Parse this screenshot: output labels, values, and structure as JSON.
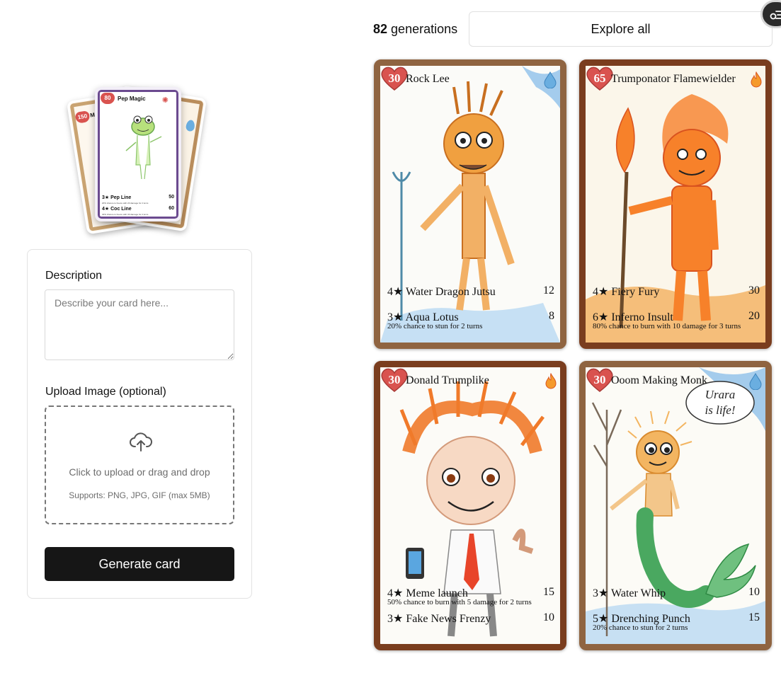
{
  "logo": {
    "back_card": {
      "hp": "150",
      "name": "M"
    },
    "front_card": {
      "hp": "80",
      "name": "Pep Magic",
      "attacks": [
        {
          "label": "3★ Pep Line",
          "damage": "50",
          "effect": "20% chance to freeze with 20 damage for 2 turns"
        },
        {
          "label": "4★ Coc Line",
          "damage": "60",
          "effect": "40% chance to freeze with 30 damage for 2 turns"
        }
      ]
    }
  },
  "form": {
    "description_label": "Description",
    "description_placeholder": "Describe your card here...",
    "upload_label": "Upload Image (optional)",
    "upload_main": "Click to upload or drag and drop",
    "upload_sub": "Supports: PNG, JPG, GIF (max 5MB)",
    "generate_label": "Generate card"
  },
  "header": {
    "count": "82",
    "count_suffix": "generations",
    "explore_label": "Explore all"
  },
  "cards": [
    {
      "hp": "30",
      "name": "Rock Lee",
      "element": "water",
      "attack1": {
        "label": "4★ Water Dragon Jutsu",
        "damage": "12"
      },
      "attack2": {
        "label": "3★ Aqua Lotus",
        "damage": "8"
      },
      "effect": "20% chance to stun  for 2 turns"
    },
    {
      "hp": "65",
      "name": "Trumponator Flamewielder",
      "element": "fire",
      "attack1": {
        "label": "4★ Fiery Fury",
        "damage": "30"
      },
      "attack2": {
        "label": "6★ Inferno Insult",
        "damage": "20"
      },
      "effect": "80% chance to burn with 10 damage for 3 turns"
    },
    {
      "hp": "30",
      "name": "Donald Trumplike",
      "element": "fire",
      "attack1": {
        "label": "4★ Meme launch",
        "damage": "15"
      },
      "attack2": {
        "label": "3★ Fake News Frenzy",
        "damage": "10"
      },
      "effect": "50% chance to burn with 5 damage for 2 turns"
    },
    {
      "hp": "30",
      "name": "Ooom Making Monk",
      "element": "water",
      "attack1": {
        "label": "3★ Water Whip",
        "damage": "10"
      },
      "attack2": {
        "label": "5★ Drenching Punch",
        "damage": "15"
      },
      "effect": "20% chance to stun  for 2 turns",
      "speech": [
        "Urara",
        "is life!"
      ]
    }
  ],
  "colors": {
    "primary_button": "#161616",
    "heart": "#d9534f",
    "water_frame": "#8f6441",
    "fire_frame": "#7a3d1e"
  },
  "icons": [
    "upload-cloud-icon",
    "heart-icon",
    "water-drop-icon",
    "fire-icon",
    "settings-fab-icon"
  ]
}
